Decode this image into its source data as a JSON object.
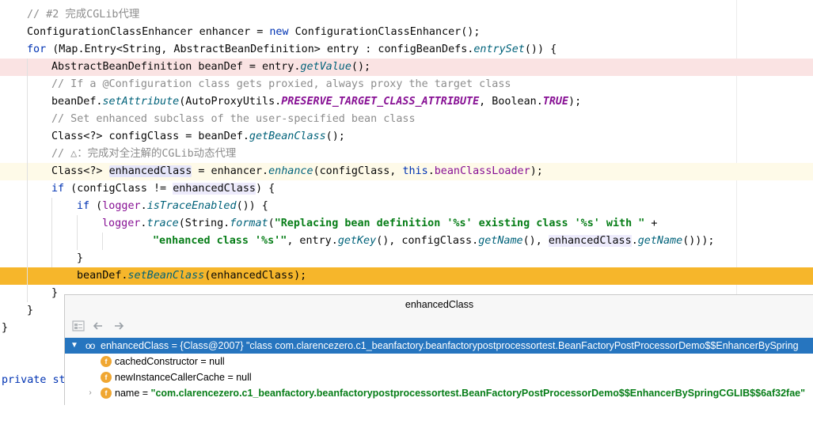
{
  "editor": {
    "lines": [
      {
        "c1": "// #2 完成CGLib代理"
      },
      {
        "t1": "ConfigurationClassEnhancer enhancer = ",
        "kw": "new",
        "t2": " ConfigurationClassEnhancer();"
      },
      {
        "kw": "for",
        "t1": " (Map.Entry<String, AbstractBeanDefinition> entry : configBeanDefs.",
        "m1": "entrySet",
        "t2": "()) {"
      },
      {
        "t1": "AbstractBeanDefinition beanDef = entry.",
        "m1": "getValue",
        "t2": "();"
      },
      {
        "c1": "// If a @Configuration class gets proxied, always proxy the target class"
      },
      {
        "t1": "beanDef.",
        "m1": "setAttribute",
        "t2": "(AutoProxyUtils.",
        "k1": "PRESERVE_TARGET_CLASS_ATTRIBUTE",
        "t3": ", Boolean.",
        "k2": "TRUE",
        "t4": ");"
      },
      {
        "c1": "// Set enhanced subclass of the user-specified bean class"
      },
      {
        "t1": "Class<?> configClass = beanDef.",
        "m1": "getBeanClass",
        "t2": "();"
      },
      {
        "c1": "// △：完成对全注解的CGLib动态代理"
      },
      {
        "t1": "Class<?> ",
        "h1": "enhancedClass",
        "t2": " = enhancer.",
        "m1": "enhance",
        "t3": "(configClass, ",
        "kw": "this",
        "t4": ".",
        "f1": "beanClassLoader",
        "t5": ");"
      },
      {
        "kw": "if",
        "t1": " (configClass != ",
        "h1": "enhancedClass",
        "t2": ") {"
      },
      {
        "kw": "if",
        "t1": " (",
        "f1": "logger",
        "t2": ".",
        "m1": "isTraceEnabled",
        "t3": "()) {"
      },
      {
        "f1": "logger",
        "t1": ".",
        "m1": "trace",
        "t2": "(String.",
        "m2": "format",
        "t3": "(",
        "s1": "\"Replacing bean definition '%s' existing class '%s' with \"",
        "t4": " +"
      },
      {
        "s1": "\"enhanced class '%s'\"",
        "t1": ", entry.",
        "m1": "getKey",
        "t2": "(), configClass.",
        "m2": "getName",
        "t3": "(), ",
        "h1": "enhancedClass",
        "t4": ".",
        "m3": "getName",
        "t5": "()));"
      },
      {
        "t1": "}"
      },
      {
        "t1": "beanDef.",
        "m1": "setBeanClass",
        "t2": "(enhancedClass);"
      },
      {
        "t1": "}"
      },
      {
        "t1": "}"
      },
      {
        "t1": "}"
      },
      {
        "t1": "private st"
      }
    ]
  },
  "popup": {
    "title": "enhancedClass",
    "toolbar": {
      "icon1": "tree-view-icon",
      "icon2": "back-arrow-icon",
      "icon3": "forward-arrow-icon"
    },
    "rows": [
      {
        "name": "enhancedClass",
        "eq": " = ",
        "value": "{Class@2007} \"class com.clarencezero.c1_beanfactory.beanfactorypostprocessortest.BeanFactoryPostProcessorDemo$$EnhancerBySpring"
      },
      {
        "badge": "f",
        "name": "cachedConstructor",
        "eq": " = ",
        "value": "null"
      },
      {
        "badge": "f",
        "name": "newInstanceCallerCache",
        "eq": " = ",
        "value": "null"
      },
      {
        "badge": "f",
        "name": "name",
        "eq": " = ",
        "value": "\"com.clarencezero.c1_beanfactory.beanfactorypostprocessortest.BeanFactoryPostProcessorDemo$$EnhancerBySpringCGLIB$$6af32fae\""
      }
    ]
  },
  "colors": {
    "selection": "#2675bf",
    "execution_line": "#f6b62b",
    "breakpoint_line": "#fae3e3",
    "field_badge": "#f0a732"
  }
}
